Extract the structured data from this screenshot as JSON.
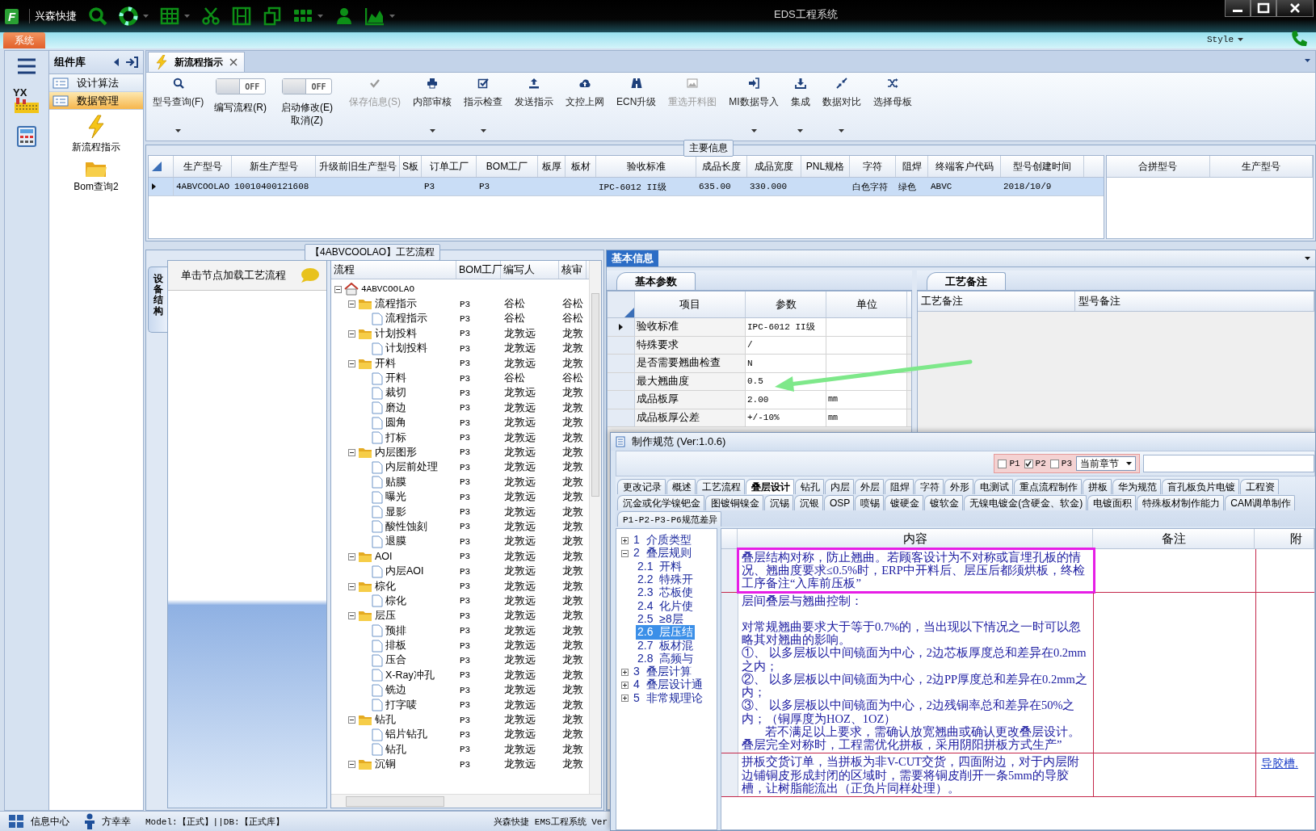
{
  "titlebar": {
    "logo_text": "F",
    "app_name": "兴森快捷",
    "title": "EDS工程系统",
    "menu_tab": "系统",
    "style_menu": "Style"
  },
  "sidebar": {
    "strip_logo_text": "YX",
    "title": "组件库",
    "groups": [
      {
        "label": "设计算法",
        "selected": false
      },
      {
        "label": "数据管理",
        "selected": true
      }
    ],
    "shortcuts": [
      {
        "label": "新流程指示",
        "kind": "lightning"
      },
      {
        "label": "Bom查询2",
        "kind": "folder"
      }
    ]
  },
  "document_tab": {
    "label": "新流程指示",
    "selected": true
  },
  "ribbon": [
    {
      "kind": "button",
      "label": "型号查询(F)",
      "dropdown": true,
      "disabled": false
    },
    {
      "kind": "toggle",
      "label": "编写流程(R)",
      "state_text": "OFF",
      "on": false
    },
    {
      "kind": "toggle",
      "label": "启动修改(E)",
      "sub_label": "取消(Z)",
      "state_text": "OFF",
      "on": false
    },
    {
      "kind": "button",
      "label": "保存信息(S)",
      "dropdown": false,
      "disabled": true
    },
    {
      "kind": "button",
      "label": "内部审核",
      "dropdown": true,
      "disabled": false
    },
    {
      "kind": "button",
      "label": "指示检查",
      "dropdown": true,
      "disabled": false
    },
    {
      "kind": "button",
      "label": "发送指示",
      "dropdown": false,
      "disabled": false
    },
    {
      "kind": "button",
      "label": "文控上网",
      "dropdown": false,
      "disabled": false
    },
    {
      "kind": "button",
      "label": "ECN升级",
      "dropdown": false,
      "disabled": false
    },
    {
      "kind": "button",
      "label": "重选开料图",
      "dropdown": false,
      "disabled": true
    },
    {
      "kind": "button",
      "label": "MI数据导入",
      "dropdown": true,
      "disabled": false
    },
    {
      "kind": "button",
      "label": "集成",
      "dropdown": true,
      "disabled": false
    },
    {
      "kind": "button",
      "label": "数据对比",
      "dropdown": true,
      "disabled": false
    },
    {
      "kind": "button",
      "label": "选择母板",
      "dropdown": false,
      "disabled": false
    }
  ],
  "main_info": {
    "title": "主要信息",
    "columns": [
      "生产型号",
      "新生产型号",
      "升级前旧生产型号",
      "S板",
      "订单工厂",
      "BOM工厂",
      "板厚",
      "板材",
      "验收标准",
      "成品长度",
      "成品宽度",
      "PNL规格",
      "字符",
      "阻焊",
      "终端客户代码",
      "型号创建时间"
    ],
    "rows": [
      {
        "selected": true,
        "cells": [
          "4ABVCOOLAO",
          "10010400121608",
          null,
          null,
          "P3",
          "P3",
          null,
          null,
          "IPC-6012 II级",
          "635.00",
          "330.000",
          null,
          "白色字符",
          "绿色",
          "ABVC",
          "2018/10/9"
        ]
      }
    ],
    "merge_columns": [
      "合拼型号",
      "生产型号"
    ]
  },
  "flow": {
    "title": "【4ABVCOOLAO】工艺流程",
    "side_tab": "设备结构",
    "hint": "单击节点加载工艺流程",
    "columns": [
      "流程",
      "BOM工厂",
      "编写人",
      "核审"
    ],
    "tree": [
      {
        "label": "4ABVCOOLAO",
        "kind": "root",
        "expanded": true,
        "children": [
          {
            "label": "流程指示",
            "kind": "folder",
            "factory": "P3",
            "writer": "谷松",
            "reviewer": "谷松",
            "expanded": true,
            "children": [
              {
                "label": "流程指示",
                "kind": "file",
                "factory": "P3",
                "writer": "谷松",
                "reviewer": "谷松"
              }
            ]
          },
          {
            "label": "计划投料",
            "kind": "folder",
            "factory": "P3",
            "writer": "龙敦远",
            "reviewer": "龙敦",
            "expanded": true,
            "children": [
              {
                "label": "计划投料",
                "kind": "file",
                "factory": "P3",
                "writer": "龙敦远",
                "reviewer": "龙敦"
              }
            ]
          },
          {
            "label": "开料",
            "kind": "folder",
            "factory": "P3",
            "writer": "龙敦远",
            "reviewer": "龙敦",
            "expanded": true,
            "children": [
              {
                "label": "开料",
                "kind": "file",
                "factory": "P3",
                "writer": "谷松",
                "reviewer": "谷松"
              },
              {
                "label": "裁切",
                "kind": "file",
                "factory": "P3",
                "writer": "龙敦远",
                "reviewer": "龙敦"
              },
              {
                "label": "磨边",
                "kind": "file",
                "factory": "P3",
                "writer": "龙敦远",
                "reviewer": "龙敦"
              },
              {
                "label": "圆角",
                "kind": "file",
                "factory": "P3",
                "writer": "龙敦远",
                "reviewer": "龙敦"
              },
              {
                "label": "打标",
                "kind": "file",
                "factory": "P3",
                "writer": "龙敦远",
                "reviewer": "龙敦"
              }
            ]
          },
          {
            "label": "内层图形",
            "kind": "folder",
            "factory": "P3",
            "writer": "龙敦远",
            "reviewer": "龙敦",
            "expanded": true,
            "children": [
              {
                "label": "内层前处理",
                "kind": "file",
                "factory": "P3",
                "writer": "龙敦远",
                "reviewer": "龙敦"
              },
              {
                "label": "贴膜",
                "kind": "file",
                "factory": "P3",
                "writer": "龙敦远",
                "reviewer": "龙敦"
              },
              {
                "label": "曝光",
                "kind": "file",
                "factory": "P3",
                "writer": "龙敦远",
                "reviewer": "龙敦"
              },
              {
                "label": "显影",
                "kind": "file",
                "factory": "P3",
                "writer": "龙敦远",
                "reviewer": "龙敦"
              },
              {
                "label": "酸性蚀刻",
                "kind": "file",
                "factory": "P3",
                "writer": "龙敦远",
                "reviewer": "龙敦"
              },
              {
                "label": "退膜",
                "kind": "file",
                "factory": "P3",
                "writer": "龙敦远",
                "reviewer": "龙敦"
              }
            ]
          },
          {
            "label": "AOI",
            "kind": "folder",
            "factory": "P3",
            "writer": "龙敦远",
            "reviewer": "龙敦",
            "expanded": true,
            "children": [
              {
                "label": "内层AOI",
                "kind": "file",
                "factory": "P3",
                "writer": "龙敦远",
                "reviewer": "龙敦"
              }
            ]
          },
          {
            "label": "棕化",
            "kind": "folder",
            "factory": "P3",
            "writer": "龙敦远",
            "reviewer": "龙敦",
            "expanded": true,
            "children": [
              {
                "label": "棕化",
                "kind": "file",
                "factory": "P3",
                "writer": "龙敦远",
                "reviewer": "龙敦"
              }
            ]
          },
          {
            "label": "层压",
            "kind": "folder",
            "factory": "P3",
            "writer": "龙敦远",
            "reviewer": "龙敦",
            "expanded": true,
            "children": [
              {
                "label": "预排",
                "kind": "file",
                "factory": "P3",
                "writer": "龙敦远",
                "reviewer": "龙敦"
              },
              {
                "label": "排板",
                "kind": "file",
                "factory": "P3",
                "writer": "龙敦远",
                "reviewer": "龙敦"
              },
              {
                "label": "压合",
                "kind": "file",
                "factory": "P3",
                "writer": "龙敦远",
                "reviewer": "龙敦"
              },
              {
                "label": "X-Ray冲孔",
                "kind": "file",
                "factory": "P3",
                "writer": "龙敦远",
                "reviewer": "龙敦"
              },
              {
                "label": "铣边",
                "kind": "file",
                "factory": "P3",
                "writer": "龙敦远",
                "reviewer": "龙敦"
              },
              {
                "label": "打字唛",
                "kind": "file",
                "factory": "P3",
                "writer": "龙敦远",
                "reviewer": "龙敦"
              }
            ]
          },
          {
            "label": "钻孔",
            "kind": "folder",
            "factory": "P3",
            "writer": "龙敦远",
            "reviewer": "龙敦",
            "expanded": true,
            "children": [
              {
                "label": "铝片钻孔",
                "kind": "file",
                "factory": "P3",
                "writer": "龙敦远",
                "reviewer": "龙敦"
              },
              {
                "label": "钻孔",
                "kind": "file",
                "factory": "P3",
                "writer": "龙敦远",
                "reviewer": "龙敦"
              }
            ]
          },
          {
            "label": "沉铜",
            "kind": "folder",
            "factory": "P3",
            "writer": "龙敦远",
            "reviewer": "龙敦",
            "expanded": true
          }
        ]
      }
    ]
  },
  "basic_info": {
    "tab": "基本信息",
    "params_tab": "基本参数",
    "columns": [
      "项目",
      "参数",
      "单位"
    ],
    "rows": [
      {
        "item": "验收标准",
        "value": "IPC-6012 II级",
        "selected": true
      },
      {
        "item": "特殊要求",
        "value": "/",
        "selected": false
      },
      {
        "item": "是否需要翘曲检查",
        "value": "N",
        "selected": false
      },
      {
        "item": "最大翘曲度",
        "value": "0.5",
        "selected": false
      },
      {
        "item": "成品板厚",
        "value": "2.00",
        "unit": "mm",
        "selected": false
      },
      {
        "item": "成品板厚公差",
        "value": "+/-10%",
        "unit": "mm",
        "selected": false
      }
    ],
    "notes_tab": "工艺备注",
    "notes_columns": [
      "工艺备注",
      "型号备注"
    ]
  },
  "spec_window": {
    "title": "制作规范 (Ver:1.0.6)",
    "filters": [
      {
        "label": "P1",
        "checked": false
      },
      {
        "label": "P2",
        "checked": true
      },
      {
        "label": "P3",
        "checked": false
      }
    ],
    "scope": "当前章节",
    "tab_rows": [
      [
        {
          "label": "更改记录",
          "selected": false
        },
        {
          "label": "概述",
          "selected": false
        },
        {
          "label": "工艺流程",
          "selected": false
        },
        {
          "label": "叠层设计",
          "selected": true
        },
        {
          "label": "钻孔",
          "selected": false
        },
        {
          "label": "内层",
          "selected": false
        },
        {
          "label": "外层",
          "selected": false
        },
        {
          "label": "阻焊",
          "selected": false
        },
        {
          "label": "字符",
          "selected": false
        },
        {
          "label": "外形",
          "selected": false
        },
        {
          "label": "电测试",
          "selected": false
        },
        {
          "label": "重点流程制作",
          "selected": false
        },
        {
          "label": "拼板",
          "selected": false
        },
        {
          "label": "华为规范",
          "selected": false
        },
        {
          "label": "盲孔板负片电镀",
          "selected": false
        },
        {
          "label": "工程资",
          "selected": false
        }
      ],
      [
        {
          "label": "沉金或化学镍钯金",
          "selected": false
        },
        {
          "label": "图镀铜镍金",
          "selected": false
        },
        {
          "label": "沉锡",
          "selected": false
        },
        {
          "label": "沉银",
          "selected": false
        },
        {
          "label": "OSP",
          "selected": false
        },
        {
          "label": "喷锡",
          "selected": false
        },
        {
          "label": "镀硬金",
          "selected": false
        },
        {
          "label": "镀软金",
          "selected": false
        },
        {
          "label": "无镍电镀金(含硬金、软金)",
          "selected": false
        },
        {
          "label": "电镀面积",
          "selected": false
        },
        {
          "label": "特殊板材制作能力",
          "selected": false
        },
        {
          "label": "CAM调单制作",
          "selected": false
        }
      ],
      [
        {
          "label": "P1-P2-P3-P6规范差异",
          "selected": false
        }
      ]
    ],
    "chapters": [
      {
        "number": "1",
        "label": "介质类型",
        "expanded": false,
        "selected": false
      },
      {
        "number": "2",
        "label": "叠层规则",
        "expanded": true,
        "selected": false,
        "children": [
          {
            "number": "2.1",
            "label": "开料",
            "selected": false
          },
          {
            "number": "2.2",
            "label": "特殊开",
            "selected": false
          },
          {
            "number": "2.3",
            "label": "芯板使",
            "selected": false
          },
          {
            "number": "2.4",
            "label": "化片使",
            "selected": false
          },
          {
            "number": "2.5",
            "label": "≥8层",
            "selected": false
          },
          {
            "number": "2.6",
            "label": "层压结",
            "selected": true
          },
          {
            "number": "2.7",
            "label": "板材混",
            "selected": false
          },
          {
            "number": "2.8",
            "label": "高频与",
            "selected": false
          }
        ]
      },
      {
        "number": "3",
        "label": "叠层计算",
        "expanded": false,
        "selected": false
      },
      {
        "number": "4",
        "label": "叠层设计通",
        "expanded": false,
        "selected": false
      },
      {
        "number": "5",
        "label": "非常规理论",
        "expanded": false,
        "selected": false
      }
    ],
    "columns": [
      "内容",
      "备注",
      "附"
    ],
    "rows": [
      {
        "highlighted": true,
        "content": [
          "叠层结构对称，防止翘曲。若顾客设计为不对称或盲埋孔板的情况、翘曲度要求≤0.5%时，ERP中开料后、层压后都须烘板，终检工序备注“入库前压板”"
        ]
      },
      {
        "highlighted": false,
        "content": [
          "层间叠层与翘曲控制：",
          "对常规翘曲要求大于等于0.7%的，当出现以下情况之一时可以忽略其对翘曲的影响。",
          "①、 以多层板以中间镜面为中心，2边芯板厚度总和差异在0.2mm之内；",
          "②、 以多层板以中间镜面为中心，2边PP厚度总和差异在0.2mm之内；",
          "③、 以多层板以中间镜面为中心，2边残铜率总和差异在50%之内；（铜厚度为HOZ、1OZ）",
          "若不满足以上要求，需确认放宽翘曲或确认更改叠层设计。叠层完全对称时，工程需优化拼板，采用阴阳拼板方式生产”"
        ]
      },
      {
        "highlighted": false,
        "content": [
          "拼板交货订单，当拼板为非V-CUT交货，四面附边，对于内层附边铺铜皮形成封闭的区域时，需要将铜皮削开一条5mm的导胶槽，让树脂能流出（正负片同样处理）。"
        ],
        "attachment": "导胶槽."
      }
    ]
  },
  "status_bar": {
    "items": [
      {
        "label": "信息中心",
        "kind": "windows"
      },
      {
        "label": "方幸幸",
        "kind": "user"
      }
    ],
    "model_db": "Model:【正式】||DB:【正式库】",
    "system": "兴森快捷 EMS工程系统 Ver"
  }
}
